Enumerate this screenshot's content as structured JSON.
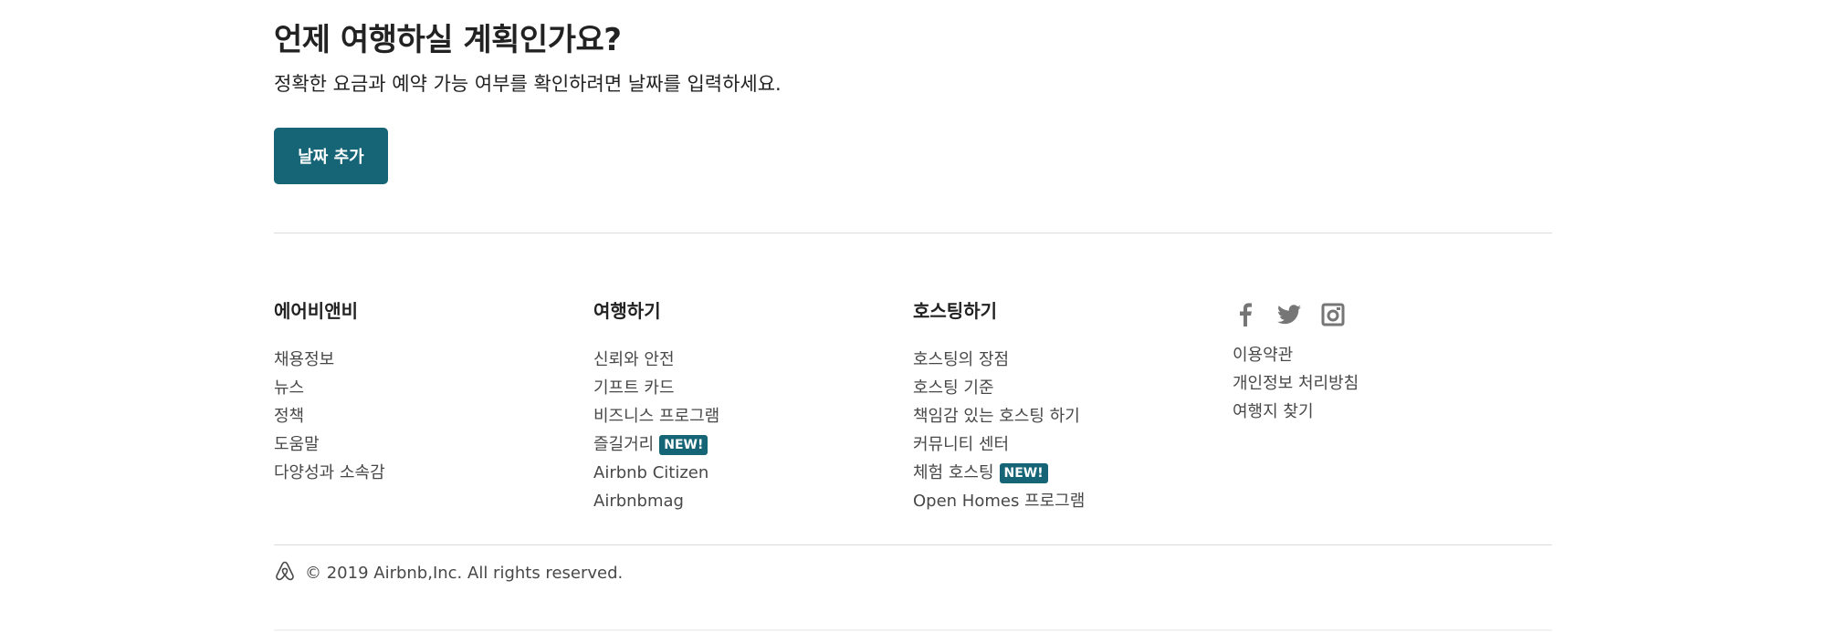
{
  "main": {
    "heading": "언제 여행하실 계획인가요?",
    "subtext": "정확한 요금과 예약 가능 여부를 확인하려면 날짜를 입력하세요.",
    "add_dates_label": "날짜 추가"
  },
  "footer": {
    "columns": [
      {
        "title": "에어비앤비",
        "items": [
          {
            "label": "채용정보"
          },
          {
            "label": "뉴스"
          },
          {
            "label": "정책"
          },
          {
            "label": "도움말"
          },
          {
            "label": "다양성과 소속감"
          }
        ]
      },
      {
        "title": "여행하기",
        "items": [
          {
            "label": "신뢰와 안전"
          },
          {
            "label": "기프트 카드"
          },
          {
            "label": "비즈니스 프로그램"
          },
          {
            "label": "즐길거리",
            "badge": "NEW!"
          },
          {
            "label": "Airbnb Citizen"
          },
          {
            "label": "Airbnbmag"
          }
        ]
      },
      {
        "title": "호스팅하기",
        "items": [
          {
            "label": "호스팅의 장점"
          },
          {
            "label": "호스팅 기준"
          },
          {
            "label": "책임감 있는 호스팅 하기"
          },
          {
            "label": "커뮤니티 센터"
          },
          {
            "label": "체험 호스팅",
            "badge": "NEW!"
          },
          {
            "label": "Open Homes 프로그램"
          }
        ]
      }
    ],
    "social_icons": [
      "facebook-icon",
      "twitter-icon",
      "instagram-icon"
    ],
    "legal_links": [
      {
        "label": "이용약관"
      },
      {
        "label": "개인정보 처리방침"
      },
      {
        "label": "여행지 찾기"
      }
    ],
    "copyright": "© 2019 Airbnb,Inc. All rights reserved."
  },
  "colors": {
    "accent": "#166577",
    "heading_text": "#222222",
    "body_text": "#484848",
    "icon_gray": "#767676",
    "divider": "#dcdcdc"
  }
}
